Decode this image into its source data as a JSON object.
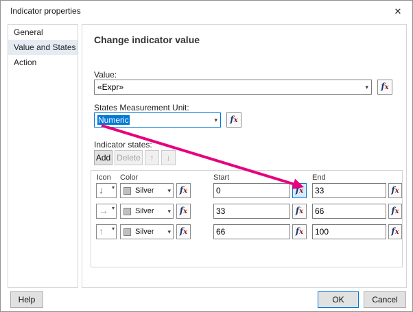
{
  "colors": {
    "annotation_pink": "#e6007e",
    "selection_blue": "#0078d7",
    "silver_swatch": "#c0c0c0"
  },
  "dialog": {
    "title": "Indicator properties"
  },
  "icons": {
    "close": "✕",
    "dropdown_caret": "▾",
    "up_arrow": "↑",
    "down_arrow": "↓"
  },
  "sidebar": {
    "items": [
      {
        "label": "General"
      },
      {
        "label": "Value and States"
      },
      {
        "label": "Action"
      }
    ],
    "selected": "Value and States"
  },
  "main": {
    "heading": "Change indicator value",
    "value": {
      "label": "Value:",
      "value": "«Expr»"
    },
    "unit": {
      "label": "States Measurement Unit:",
      "value": "Numeric"
    },
    "states": {
      "label": "Indicator states:",
      "add_label": "Add",
      "delete_label": "Delete",
      "table": {
        "headers": [
          "Icon",
          "Color",
          "Start",
          "End"
        ],
        "rows": [
          {
            "icon": "down-arrow-icon",
            "icon_glyph": "↓",
            "color": "Silver",
            "start": "0",
            "end": "33"
          },
          {
            "icon": "right-arrow-icon",
            "icon_glyph": "→",
            "color": "Silver",
            "start": "33",
            "end": "66"
          },
          {
            "icon": "up-arrow-icon",
            "icon_glyph": "↑",
            "color": "Silver",
            "start": "66",
            "end": "100"
          }
        ]
      }
    }
  },
  "fx": {
    "f": "f",
    "x": "x"
  },
  "footer": {
    "help": "Help",
    "ok": "OK",
    "cancel": "Cancel"
  }
}
